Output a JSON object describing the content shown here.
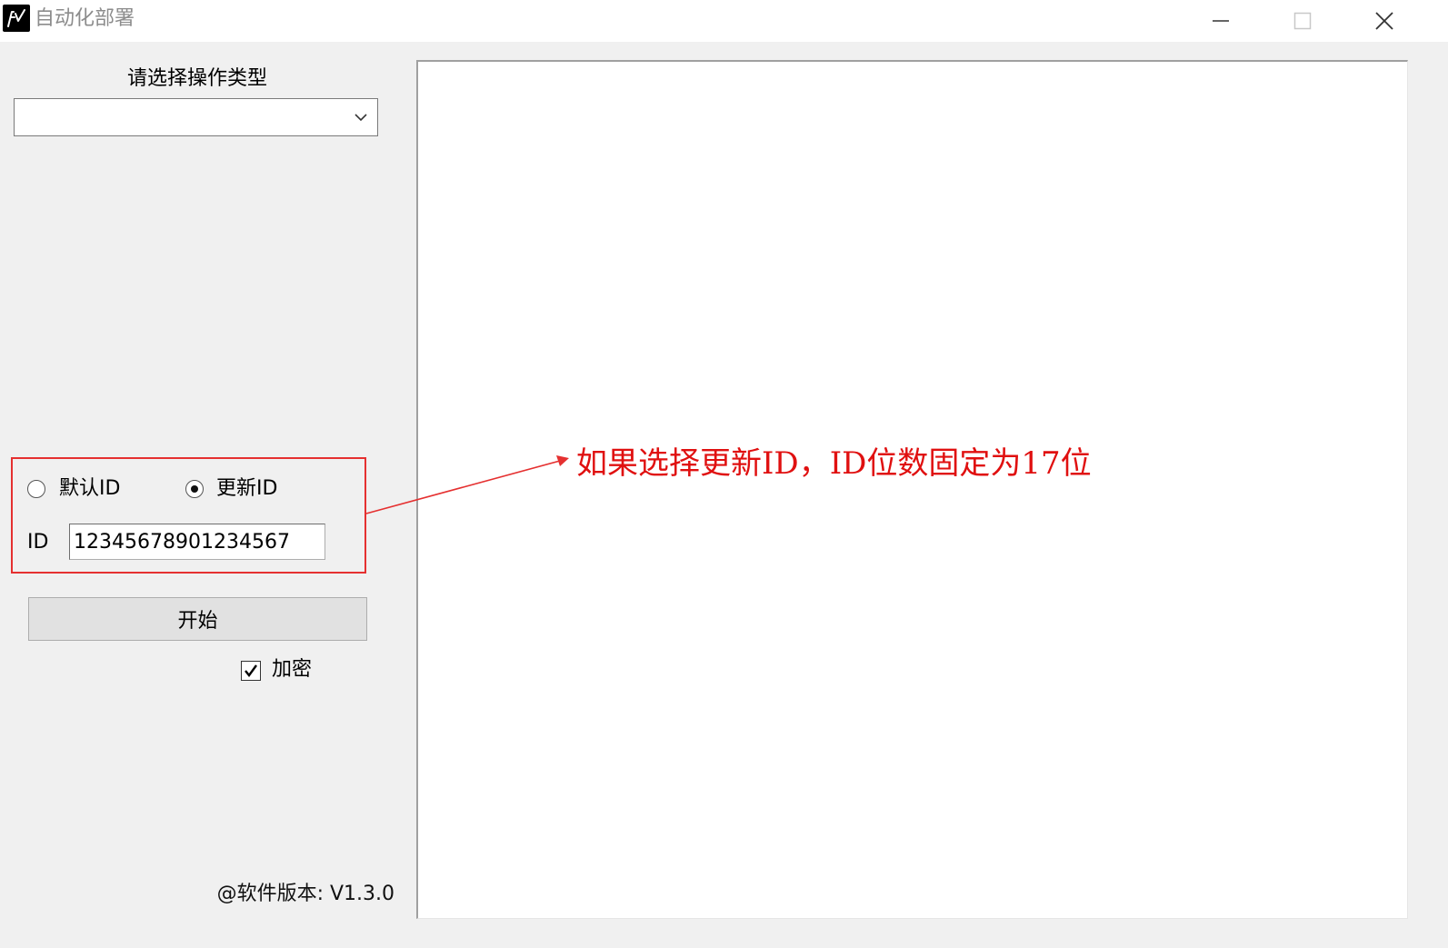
{
  "window": {
    "title": "自动化部署",
    "icons": {
      "app": "app-logo-icon",
      "minimize": "minimize-icon",
      "maximize": "maximize-icon",
      "close": "close-icon"
    }
  },
  "operation": {
    "label": "请选择操作类型",
    "selected_value": "",
    "dropdown_icon": "chevron-down-icon"
  },
  "id_mode": {
    "options": [
      {
        "label": "默认ID",
        "checked": false
      },
      {
        "label": "更新ID",
        "checked": true
      }
    ],
    "id_label": "ID",
    "id_value": "12345678901234567"
  },
  "actions": {
    "start_label": "开始",
    "encrypt_label": "加密",
    "encrypt_checked": true
  },
  "footer": {
    "version": "@软件版本: V1.3.0"
  },
  "annotation": {
    "text": "如果选择更新ID，ID位数固定为17位",
    "color": "#e01010"
  }
}
